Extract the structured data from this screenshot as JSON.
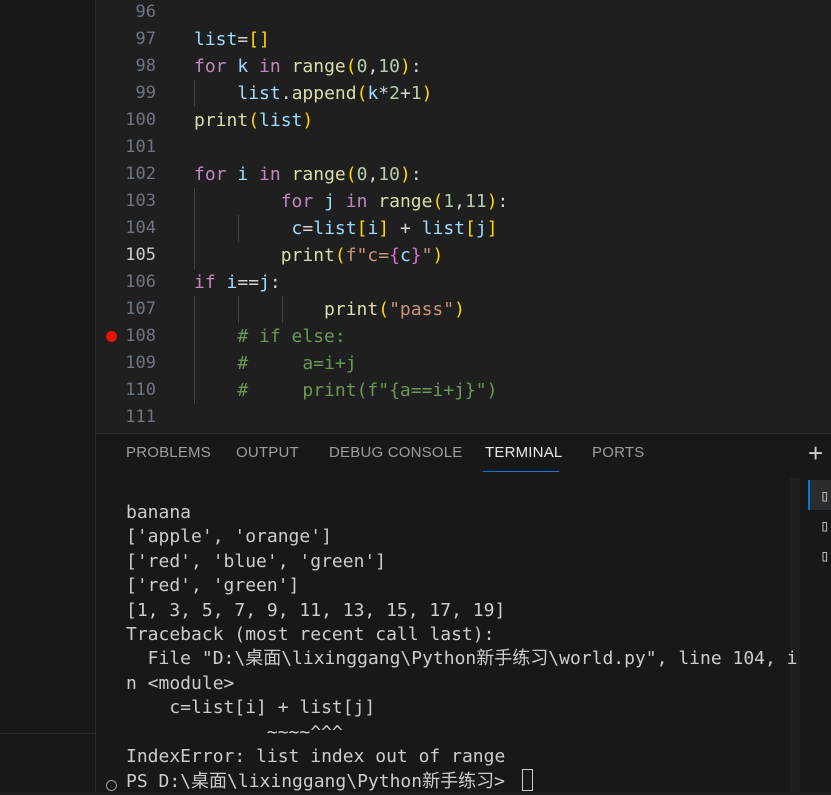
{
  "editor": {
    "active_line": "105",
    "breakpoint_line": "108",
    "lines": [
      {
        "num": "96",
        "tokens": []
      },
      {
        "num": "97",
        "tokens": [
          [
            "vb",
            "list"
          ],
          [
            "op",
            "="
          ],
          [
            "p1",
            "[]"
          ]
        ]
      },
      {
        "num": "98",
        "tokens": [
          [
            "kw",
            "for"
          ],
          [
            "op",
            " "
          ],
          [
            "vb",
            "k"
          ],
          [
            "op",
            " "
          ],
          [
            "kw",
            "in"
          ],
          [
            "op",
            " "
          ],
          [
            "fn",
            "range"
          ],
          [
            "p1",
            "("
          ],
          [
            "nm",
            "0"
          ],
          [
            "op",
            ","
          ],
          [
            "nm",
            "10"
          ],
          [
            "p1",
            ")"
          ],
          [
            "op",
            ":"
          ]
        ]
      },
      {
        "num": "99",
        "tokens": [
          [
            "op",
            "    "
          ],
          [
            "vb",
            "list"
          ],
          [
            "op",
            "."
          ],
          [
            "fn",
            "append"
          ],
          [
            "p1",
            "("
          ],
          [
            "vb",
            "k"
          ],
          [
            "op",
            "*"
          ],
          [
            "nm",
            "2"
          ],
          [
            "op",
            "+"
          ],
          [
            "nm",
            "1"
          ],
          [
            "p1",
            ")"
          ]
        ]
      },
      {
        "num": "100",
        "tokens": [
          [
            "fn",
            "print"
          ],
          [
            "p1",
            "("
          ],
          [
            "vb",
            "list"
          ],
          [
            "p1",
            ")"
          ]
        ]
      },
      {
        "num": "101",
        "tokens": []
      },
      {
        "num": "102",
        "tokens": [
          [
            "kw",
            "for"
          ],
          [
            "op",
            " "
          ],
          [
            "vb",
            "i"
          ],
          [
            "op",
            " "
          ],
          [
            "kw",
            "in"
          ],
          [
            "op",
            " "
          ],
          [
            "fn",
            "range"
          ],
          [
            "p1",
            "("
          ],
          [
            "nm",
            "0"
          ],
          [
            "op",
            ","
          ],
          [
            "nm",
            "10"
          ],
          [
            "p1",
            ")"
          ],
          [
            "op",
            ":"
          ]
        ]
      },
      {
        "num": "103",
        "tokens": [
          [
            "op",
            "        "
          ],
          [
            "kw",
            "for"
          ],
          [
            "op",
            " "
          ],
          [
            "vb",
            "j"
          ],
          [
            "op",
            " "
          ],
          [
            "kw",
            "in"
          ],
          [
            "op",
            " "
          ],
          [
            "fn",
            "range"
          ],
          [
            "p1",
            "("
          ],
          [
            "nm",
            "1"
          ],
          [
            "op",
            ","
          ],
          [
            "nm",
            "11"
          ],
          [
            "p1",
            ")"
          ],
          [
            "op",
            ":"
          ]
        ]
      },
      {
        "num": "104",
        "tokens": [
          [
            "op",
            "         "
          ],
          [
            "vb",
            "c"
          ],
          [
            "op",
            "="
          ],
          [
            "vb",
            "list"
          ],
          [
            "p1",
            "["
          ],
          [
            "vb",
            "i"
          ],
          [
            "p1",
            "]"
          ],
          [
            "op",
            " + "
          ],
          [
            "vb",
            "list"
          ],
          [
            "p1",
            "["
          ],
          [
            "vb",
            "j"
          ],
          [
            "p1",
            "]"
          ]
        ]
      },
      {
        "num": "105",
        "tokens": [
          [
            "op",
            "        "
          ],
          [
            "fn",
            "print"
          ],
          [
            "p1",
            "("
          ],
          [
            "st",
            "f\"c="
          ],
          [
            "p2",
            "{"
          ],
          [
            "vb",
            "c"
          ],
          [
            "p2",
            "}"
          ],
          [
            "st",
            "\""
          ],
          [
            "p1",
            ")"
          ]
        ]
      },
      {
        "num": "106",
        "tokens": [
          [
            "kw",
            "if"
          ],
          [
            "op",
            " "
          ],
          [
            "vb",
            "i"
          ],
          [
            "op",
            "=="
          ],
          [
            "vb",
            "j"
          ],
          [
            "op",
            ":"
          ]
        ]
      },
      {
        "num": "107",
        "tokens": [
          [
            "op",
            "            "
          ],
          [
            "fn",
            "print"
          ],
          [
            "p1",
            "("
          ],
          [
            "st",
            "\"pass\""
          ],
          [
            "p1",
            ")"
          ]
        ]
      },
      {
        "num": "108",
        "tokens": [
          [
            "op",
            "    "
          ],
          [
            "cm",
            "# if else:"
          ]
        ]
      },
      {
        "num": "109",
        "tokens": [
          [
            "op",
            "    "
          ],
          [
            "cm",
            "#     a=i+j"
          ]
        ]
      },
      {
        "num": "110",
        "tokens": [
          [
            "op",
            "    "
          ],
          [
            "cm",
            "#     print(f\"{a==i+j}\")"
          ]
        ]
      },
      {
        "num": "111",
        "tokens": []
      }
    ]
  },
  "panel": {
    "tabs": [
      {
        "label": "PROBLEMS"
      },
      {
        "label": "OUTPUT"
      },
      {
        "label": "DEBUG CONSOLE"
      },
      {
        "label": "TERMINAL"
      },
      {
        "label": "PORTS"
      }
    ],
    "active_tab": "TERMINAL",
    "plus_icon": "+",
    "terminal_lines": [
      "banana",
      "['apple', 'orange']",
      "['red', 'blue', 'green']",
      "['red', 'green']",
      "[1, 3, 5, 7, 9, 11, 13, 15, 17, 19]",
      "Traceback (most recent call last):",
      "  File \"D:\\桌面\\lixinggang\\Python新手练习\\world.py\", line 104, i",
      "n <module>",
      "    c=list[i] + list[j]",
      "             ~~~~^^^",
      "IndexError: list index out of range"
    ],
    "prompt": "PS D:\\桌面\\lixinggang\\Python新手练习> "
  },
  "colors": {
    "editor_bg": "#1f1f1f",
    "panel_bg": "#181818",
    "keyword": "#c586c0",
    "variable": "#9cdcfe",
    "function": "#dcdcaa",
    "number": "#b5cea8",
    "string": "#ce9178",
    "comment": "#6a9955",
    "bracket": "#ffd700",
    "breakpoint": "#e51400",
    "accent": "#0078d4"
  }
}
